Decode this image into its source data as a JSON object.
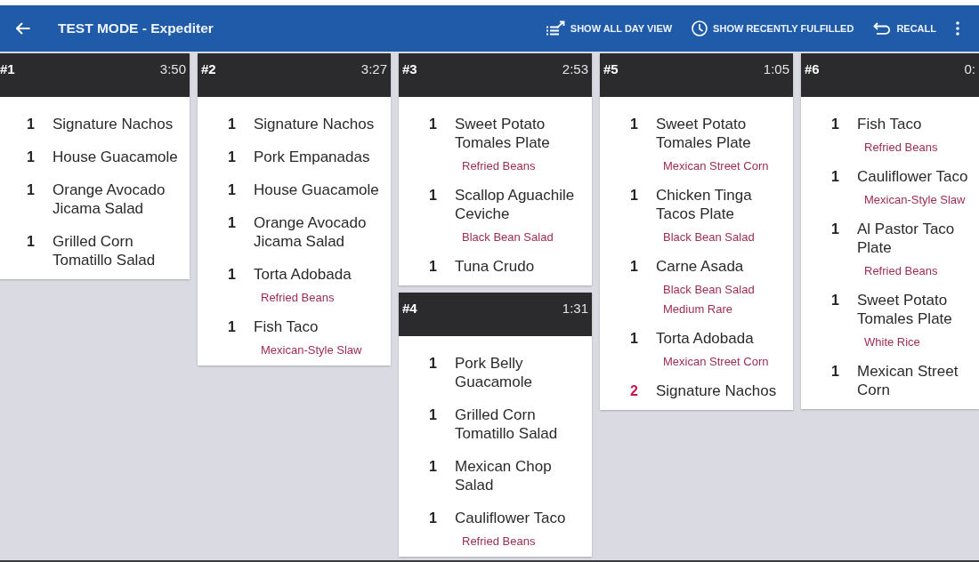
{
  "app_bar": {
    "title": "TEST MODE - Expediter",
    "actions": [
      {
        "kind": "all_day",
        "label": "SHOW ALL DAY VIEW"
      },
      {
        "kind": "fulfilled",
        "label": "SHOW RECENTLY FULFILLED"
      },
      {
        "kind": "recall",
        "label": "RECALL"
      }
    ]
  },
  "columns": [
    {
      "tickets": [
        {
          "number": "#1",
          "time": "3:50",
          "items": [
            {
              "qty": "1",
              "name": "Signature Nachos",
              "highlighted": false
            },
            {
              "qty": "1",
              "name": "House Guacamole",
              "highlighted": false
            },
            {
              "qty": "1",
              "name": "Orange Avocado Jicama Salad",
              "highlighted": false
            },
            {
              "qty": "1",
              "name": "Grilled Corn Tomatillo Salad",
              "highlighted": false
            }
          ]
        }
      ]
    },
    {
      "tickets": [
        {
          "number": "#2",
          "time": "3:27",
          "items": [
            {
              "qty": "1",
              "name": "Signature Nachos",
              "highlighted": false
            },
            {
              "qty": "1",
              "name": "Pork Empanadas",
              "highlighted": false
            },
            {
              "qty": "1",
              "name": "House Guacamole",
              "highlighted": false
            },
            {
              "qty": "1",
              "name": "Orange Avocado Jicama Salad",
              "highlighted": false
            },
            {
              "qty": "1",
              "name": "Torta Adobada",
              "highlighted": false,
              "modifiers": [
                "Refried Beans"
              ]
            },
            {
              "qty": "1",
              "name": "Fish Taco",
              "highlighted": false,
              "modifiers": [
                "Mexican-Style Slaw"
              ]
            }
          ]
        }
      ]
    },
    {
      "tickets": [
        {
          "number": "#3",
          "time": "2:53",
          "items": [
            {
              "qty": "1",
              "name": "Sweet Potato Tomales Plate",
              "highlighted": false,
              "modifiers": [
                "Refried Beans"
              ]
            },
            {
              "qty": "1",
              "name": "Scallop Aguachile Ceviche",
              "highlighted": false,
              "modifiers": [
                "Black Bean Salad"
              ]
            },
            {
              "qty": "1",
              "name": "Tuna Crudo",
              "highlighted": false
            }
          ]
        },
        {
          "number": "#4",
          "time": "1:31",
          "items": [
            {
              "qty": "1",
              "name": "Pork Belly Guacamole",
              "highlighted": false
            },
            {
              "qty": "1",
              "name": "Grilled Corn Tomatillo Salad",
              "highlighted": false
            },
            {
              "qty": "1",
              "name": "Mexican Chop Salad",
              "highlighted": false
            },
            {
              "qty": "1",
              "name": "Cauliflower Taco",
              "highlighted": false,
              "modifiers": [
                "Refried Beans"
              ]
            }
          ]
        }
      ]
    },
    {
      "tickets": [
        {
          "number": "#5",
          "time": "1:05",
          "items": [
            {
              "qty": "1",
              "name": "Sweet Potato Tomales Plate",
              "highlighted": false,
              "modifiers": [
                "Mexican Street Corn"
              ]
            },
            {
              "qty": "1",
              "name": "Chicken Tinga Tacos Plate",
              "highlighted": false,
              "modifiers": [
                "Black Bean Salad"
              ]
            },
            {
              "qty": "1",
              "name": "Carne Asada",
              "highlighted": false,
              "modifiers": [
                "Black Bean Salad",
                "Medium Rare"
              ]
            },
            {
              "qty": "1",
              "name": "Torta Adobada",
              "highlighted": false,
              "modifiers": [
                "Mexican Street Corn"
              ]
            },
            {
              "qty": "2",
              "name": "Signature Nachos",
              "highlighted": true
            }
          ]
        }
      ]
    },
    {
      "tickets": [
        {
          "number": "#6",
          "time": "0:",
          "items": [
            {
              "qty": "1",
              "name": "Fish Taco",
              "highlighted": false,
              "modifiers": [
                "Refried Beans"
              ]
            },
            {
              "qty": "1",
              "name": "Cauliflower Taco",
              "highlighted": false,
              "modifiers": [
                "Mexican-Style Slaw"
              ]
            },
            {
              "qty": "1",
              "name": "Al Pastor Taco Plate",
              "highlighted": false,
              "modifiers": [
                "Refried Beans"
              ]
            },
            {
              "qty": "1",
              "name": "Sweet Potato Tomales Plate",
              "highlighted": false,
              "modifiers": [
                "White Rice"
              ]
            },
            {
              "qty": "1",
              "name": "Mexican Street Corn",
              "highlighted": false
            }
          ]
        }
      ]
    }
  ]
}
